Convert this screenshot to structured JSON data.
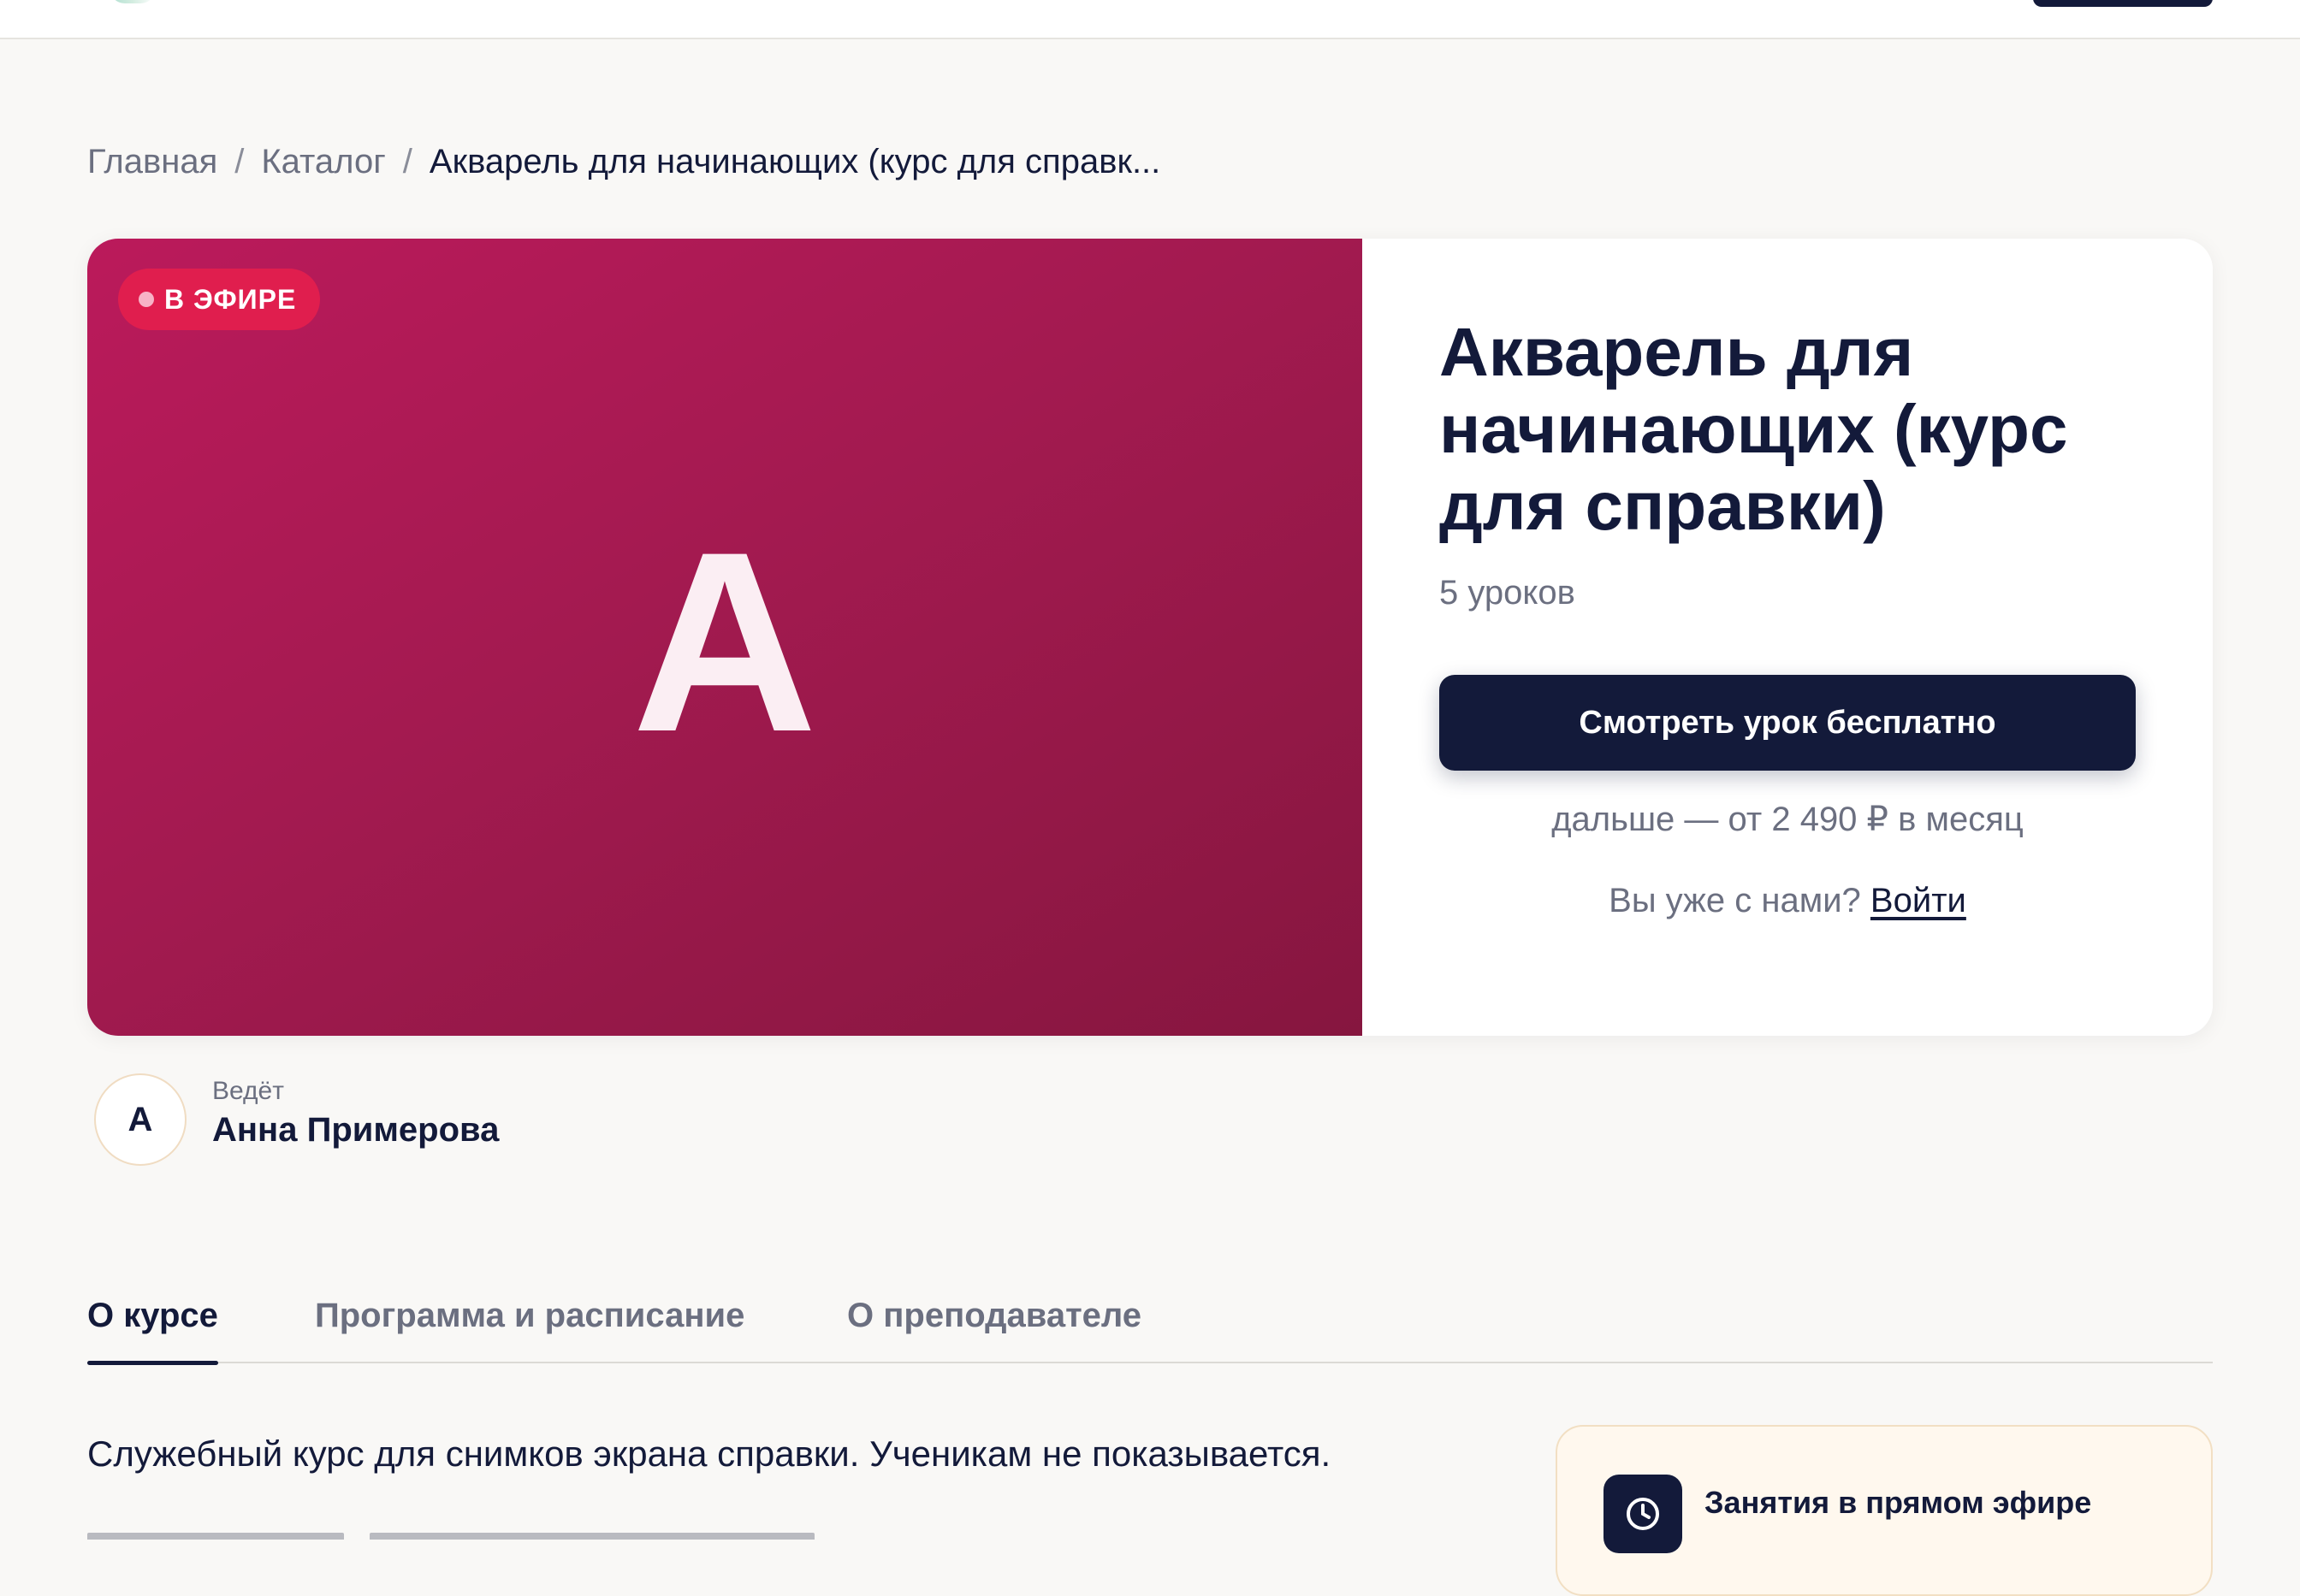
{
  "breadcrumb": {
    "items": [
      "Главная",
      "Каталог",
      "Акварель для начинающих (курс для справк..."
    ],
    "separator": "/"
  },
  "course": {
    "cover_letter": "А",
    "live_badge": "В ЭФИРЕ",
    "title": "Акварель для начинающих (курс для справки)",
    "lessons": "5 уроков",
    "cta_label": "Смотреть урок бесплатно",
    "price_note": "дальше — от 2 490 ₽ в месяц",
    "login_prompt": "Вы уже с нами?",
    "login_link": "Войти"
  },
  "teacher": {
    "avatar_letter": "А",
    "caption": "Ведёт",
    "name": "Анна Примерова"
  },
  "tabs": [
    {
      "label": "О курсе",
      "active": true
    },
    {
      "label": "Программа и расписание",
      "active": false
    },
    {
      "label": "О преподавателе",
      "active": false
    }
  ],
  "content": {
    "description": "Служебный курс для снимков экрана справки. Ученикам не показывается."
  },
  "side_card": {
    "icon": "clock-icon",
    "label": "Занятия в прямом эфире"
  },
  "colors": {
    "cover_gradient_start": "#bb1a5b",
    "cover_gradient_end": "#86163f",
    "live_badge": "#e01e4e",
    "primary_dark": "#131a3a",
    "muted_text": "#6b6f80",
    "page_background": "#f9f8f6",
    "side_card_background": "#fff8ee"
  }
}
